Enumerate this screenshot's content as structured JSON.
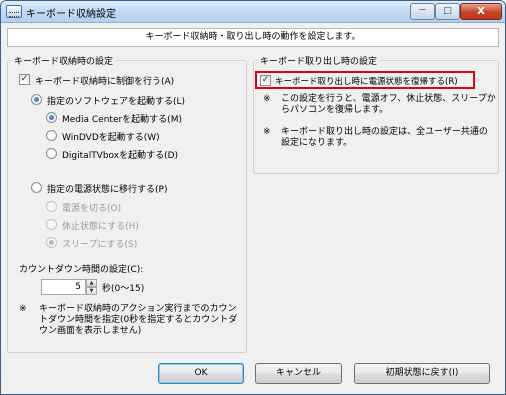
{
  "window": {
    "title": "キーボード収納設定",
    "minimize": "－",
    "maximize": "□",
    "close": "X"
  },
  "header": {
    "text": "キーボード収納時・取り出し時の動作を設定します。"
  },
  "stow": {
    "group_title": "キーボード収納時の設定",
    "control_checkbox": {
      "label": "キーボード収納時に制御を行う(A)",
      "checked": true
    },
    "launch_software": {
      "label": "指定のソフトウェアを起動する(L)",
      "selected": true
    },
    "software_options": [
      {
        "label": "Media Centerを起動する(M)",
        "selected": true,
        "enabled": true
      },
      {
        "label": "WinDVDを起動する(W)",
        "selected": false,
        "enabled": true
      },
      {
        "label": "DigitalTVboxを起動する(D)",
        "selected": false,
        "enabled": true
      }
    ],
    "power_state": {
      "label": "指定の電源状態に移行する(P)",
      "selected": false
    },
    "power_options": [
      {
        "label": "電源を切る(O)",
        "selected": false,
        "enabled": false
      },
      {
        "label": "休止状態にする(H)",
        "selected": false,
        "enabled": false
      },
      {
        "label": "スリープにする(S)",
        "selected": true,
        "enabled": false
      }
    ],
    "countdown": {
      "label": "カウントダウン時間の設定(C):",
      "value": "5",
      "unit": "秒(0～15)",
      "up": "▲",
      "down": "▼"
    },
    "note": {
      "mark": "※",
      "lines": [
        "キーボード収納時のアクション実行までのカウン",
        "トダウン時間を指定(0秒を指定するとカウントダ",
        "ウン画面を表示しません)"
      ]
    }
  },
  "unstow": {
    "group_title": "キーボード取り出し時の設定",
    "restore_checkbox": {
      "label": "キーボード取り出し時に電源状態を復帰する(R)",
      "checked": true
    },
    "notes": [
      {
        "mark": "※",
        "lines": [
          "この設定を行うと、電源オフ、休止状態、スリープか",
          "らパソコンを復帰します。"
        ]
      },
      {
        "mark": "※",
        "lines": [
          "キーボード取り出し時の設定は、全ユーザー共通の",
          "設定になります。"
        ]
      }
    ]
  },
  "buttons": {
    "ok": "OK",
    "cancel": "キャンセル",
    "reset": "初期状態に戻す(I)"
  },
  "colors": {
    "highlight": "#e0000f",
    "radio_selected": "#1d4f92",
    "title_gradient_top": "#dcecfb"
  }
}
